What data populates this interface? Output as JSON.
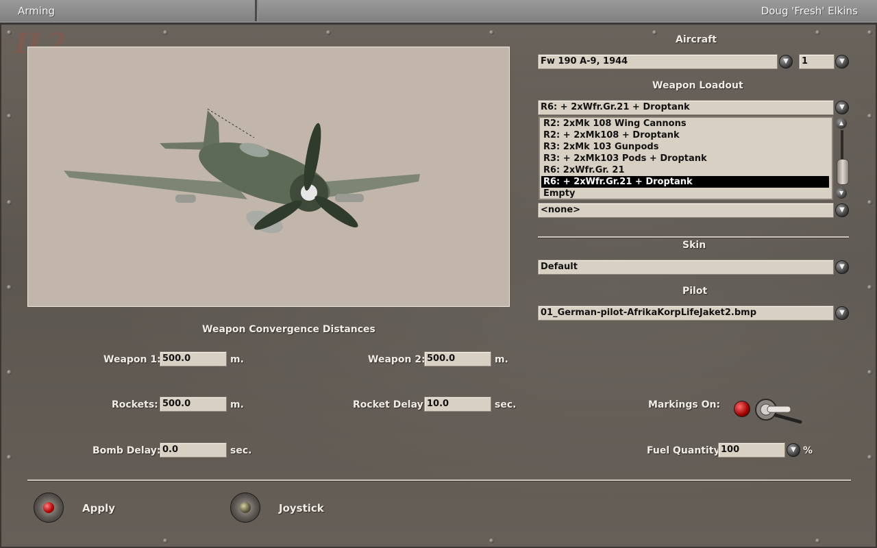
{
  "window": {
    "title": "Arming",
    "user": "Doug 'Fresh' Elkins"
  },
  "logo": {
    "text": "IL2"
  },
  "aircraft": {
    "label": "Aircraft",
    "selected": "Fw 190 A-9, 1944",
    "count": "1"
  },
  "loadout": {
    "label": "Weapon Loadout",
    "selected": "R6: + 2xWfr.Gr.21 + Droptank",
    "options": [
      "R2: 2xMk 108 Wing Cannons",
      "R2: + 2xMk108 + Droptank",
      "R3: 2xMk 103 Gunpods",
      "R3: + 2xMk103 Pods + Droptank",
      "R6: 2xWfr.Gr. 21",
      "R6: + 2xWfr.Gr.21 + Droptank",
      "Empty"
    ],
    "selected_index": 5,
    "extra": "<none>"
  },
  "skin": {
    "label": "Skin",
    "selected": "Default"
  },
  "pilot": {
    "label": "Pilot",
    "selected": "01_German-pilot-AfrikaKorpLifeJaket2.bmp"
  },
  "convergence": {
    "heading": "Weapon Convergence Distances",
    "weapon1": {
      "label": "Weapon 1:",
      "value": "500.0",
      "unit": "m."
    },
    "weapon2": {
      "label": "Weapon 2:",
      "value": "500.0",
      "unit": "m."
    },
    "rockets": {
      "label": "Rockets:",
      "value": "500.0",
      "unit": "m."
    },
    "rocket_delay": {
      "label": "Rocket Delay:",
      "value": "10.0",
      "unit": "sec."
    },
    "bomb_delay": {
      "label": "Bomb Delay:",
      "value": "0.0",
      "unit": "sec."
    }
  },
  "markings": {
    "label": "Markings On:",
    "on": true
  },
  "fuel": {
    "label": "Fuel Quantity:",
    "value": "100",
    "unit": "%"
  },
  "buttons": {
    "apply": "Apply",
    "joystick": "Joystick"
  },
  "icons": {
    "dropdown": "dropdown-arrow-icon",
    "scroll_up": "scroll-up-icon",
    "scroll_down": "scroll-down-icon"
  },
  "colors": {
    "panel": "#5e5853",
    "viewport": "#c2b5aa",
    "field": "#d9d0c4",
    "selection": "#000000",
    "lamp_red": "#b00000"
  }
}
